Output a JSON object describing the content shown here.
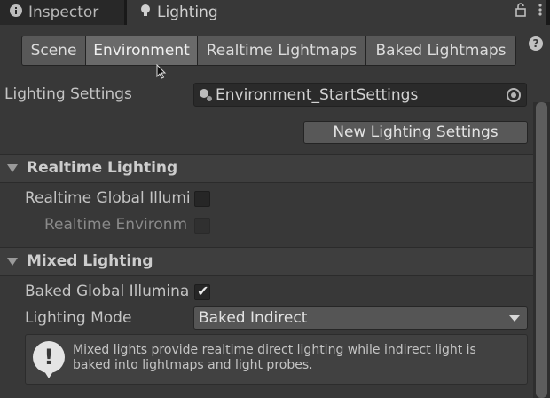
{
  "tabs": {
    "inspector_label": "Inspector",
    "lighting_label": "Lighting",
    "inspector_icon": "info-icon",
    "lighting_icon": "lightbulb-icon",
    "lock_icon": "lock-icon",
    "menu_icon": "kebab-menu-icon"
  },
  "subtabs": [
    {
      "label": "Scene",
      "active": false
    },
    {
      "label": "Environment",
      "active": true
    },
    {
      "label": "Realtime Lightmaps",
      "active": false
    },
    {
      "label": "Baked Lightmaps",
      "active": false
    }
  ],
  "lighting_settings": {
    "label": "Lighting Settings",
    "value": "Environment_StartSettings",
    "new_button": "New Lighting Settings"
  },
  "realtime": {
    "title": "Realtime Lighting",
    "gi_label": "Realtime Global Illumi",
    "gi_checked": false,
    "env_label": "Realtime Environm",
    "env_checked": false
  },
  "mixed": {
    "title": "Mixed Lighting",
    "baked_label": "Baked Global Illumina",
    "baked_checked": true,
    "mode_label": "Lighting Mode",
    "mode_value": "Baked Indirect",
    "help_text": "Mixed lights provide realtime direct lighting while indirect light is baked into lightmaps and light probes."
  },
  "colors": {
    "background": "#383838",
    "tabbar": "#191919",
    "active_subtab": "#6a6a6a"
  }
}
